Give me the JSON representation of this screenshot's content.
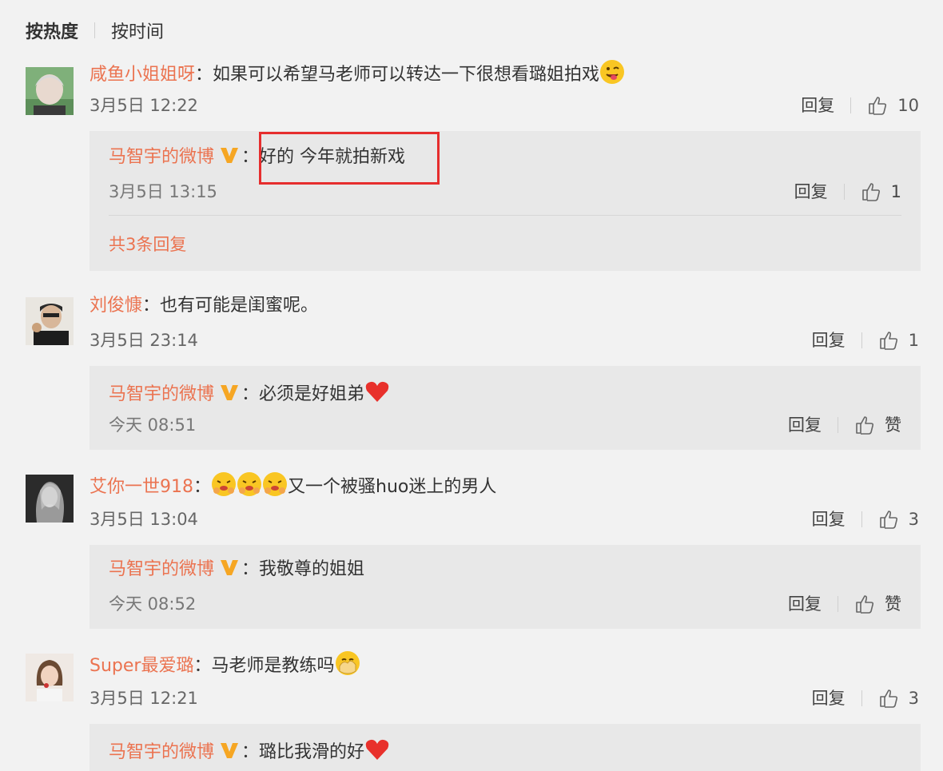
{
  "sort": {
    "hot": "按热度",
    "time": "按时间"
  },
  "brand_colors": {
    "username": "#eb7350",
    "highlight": "#e62e2e",
    "verified": "#f6a623"
  },
  "comments": [
    {
      "user": "咸鱼小姐姐呀",
      "text": "如果可以希望马老师可以转达一下很想看璐姐拍戏",
      "emoji": "tongue-wink-emoji",
      "time": "3月5日 12:22",
      "reply_label": "回复",
      "likes": "10",
      "reply": {
        "user": "马智宇的微博",
        "text": "好的 今年就拍新戏",
        "time": "3月5日 13:15",
        "reply_label": "回复",
        "likes": "1",
        "more": "共3条回复"
      }
    },
    {
      "user": "刘俊慷",
      "text": "也有可能是闺蜜呢。",
      "time": "3月5日 23:14",
      "reply_label": "回复",
      "likes": "1",
      "reply": {
        "user": "马智宇的微博",
        "text": "必须是好姐弟",
        "emoji": "heart-emoji",
        "time": "今天 08:51",
        "reply_label": "回复",
        "likes": "赞"
      }
    },
    {
      "user": "艾你一世918",
      "text": "又一个被骚huo迷上的男人",
      "emoji": "shy-emoji",
      "time": "3月5日 13:04",
      "reply_label": "回复",
      "likes": "3",
      "reply": {
        "user": "马智宇的微博",
        "text": "我敬尊的姐姐",
        "time": "今天 08:52",
        "reply_label": "回复",
        "likes": "赞"
      }
    },
    {
      "user": "Super最爱璐",
      "text": "马老师是教练吗",
      "emoji": "hand-cover-emoji",
      "time": "3月5日 12:21",
      "reply_label": "回复",
      "likes": "3",
      "reply": {
        "user": "马智宇的微博",
        "text": "璐比我滑的好",
        "emoji": "heart-emoji"
      }
    }
  ]
}
